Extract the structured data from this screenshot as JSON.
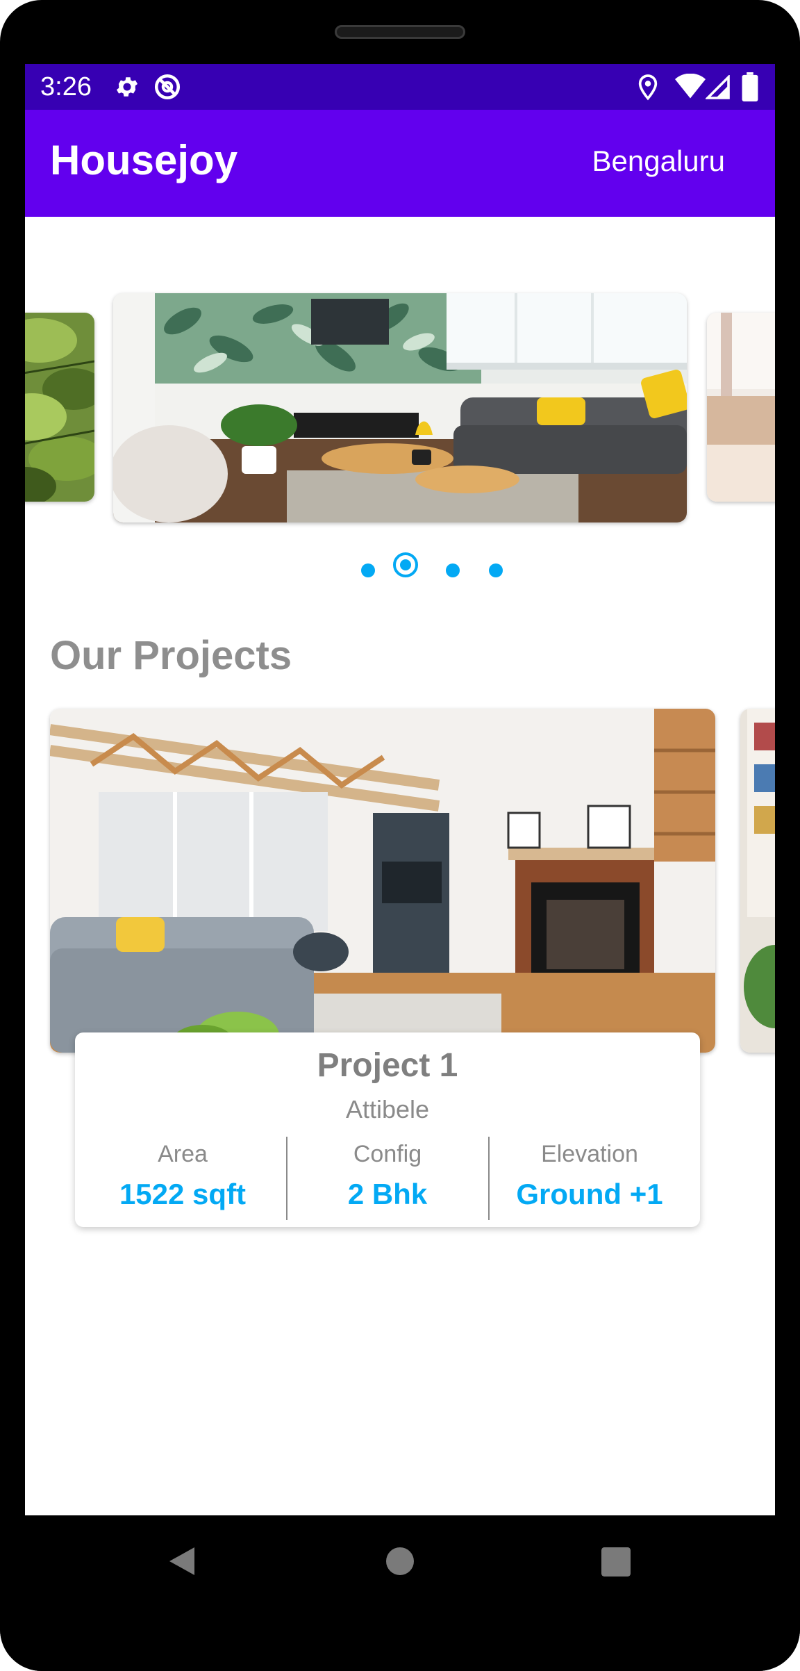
{
  "status_bar": {
    "time": "3:26",
    "icons_left": [
      "settings-icon",
      "sync-icon"
    ],
    "icons_right": [
      "location-icon",
      "wifi-icon",
      "signal-icon",
      "battery-icon"
    ]
  },
  "app_bar": {
    "title": "Housejoy",
    "city": "Bengaluru",
    "color": "#6200ee",
    "status_color": "#3700b3"
  },
  "carousel": {
    "slides": [
      "plant-image",
      "living-room-image",
      "window-room-image"
    ],
    "active_index": 1,
    "indicator_count": 4,
    "indicator_color": "#03a9f4"
  },
  "projects": {
    "title": "Our Projects",
    "items": [
      {
        "name": "Project 1",
        "location": "Attibele",
        "stats": [
          {
            "label": "Area",
            "value": "1522 sqft"
          },
          {
            "label": "Config",
            "value": "2 Bhk"
          },
          {
            "label": "Elevation",
            "value": "Ground +1"
          }
        ]
      }
    ]
  },
  "nav_bar": {
    "buttons": [
      "back-icon",
      "home-icon",
      "recents-icon"
    ]
  }
}
